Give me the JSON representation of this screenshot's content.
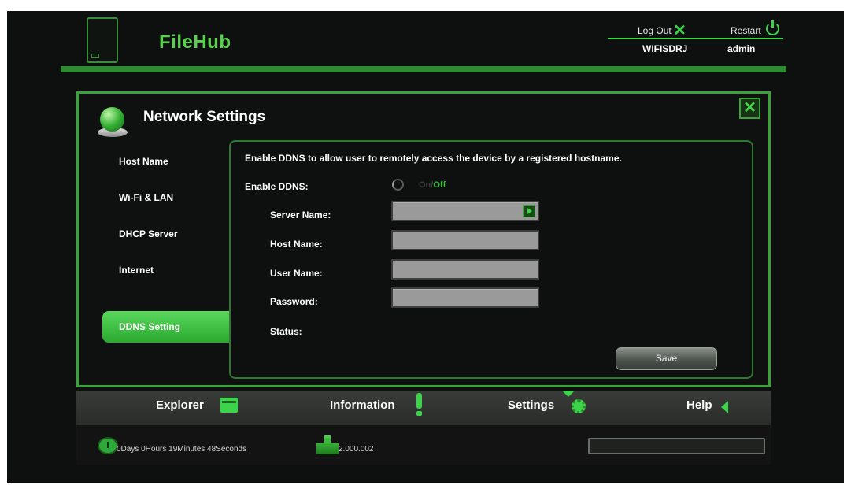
{
  "app": {
    "brand": "FileHub"
  },
  "header": {
    "logout_label": "Log Out",
    "restart_label": "Restart",
    "device_name": "WIFISDRJ",
    "username": "admin"
  },
  "panel": {
    "title": "Network Settings"
  },
  "sidebar": {
    "items": [
      {
        "label": "Host Name"
      },
      {
        "label": "Wi-Fi & LAN"
      },
      {
        "label": "DHCP Server"
      },
      {
        "label": "Internet"
      },
      {
        "label": "DDNS Setting",
        "active": true
      }
    ]
  },
  "ddns": {
    "description": "Enable DDNS to allow user to remotely access the device by a registered hostname.",
    "enable_label": "Enable DDNS:",
    "toggle_on": "On",
    "toggle_sep": "/",
    "toggle_off": "Off",
    "toggle_state": "Off",
    "server_name_label": "Server Name:",
    "server_name_value": "",
    "host_name_label": "Host Name:",
    "host_name_value": "",
    "user_name_label": "User Name:",
    "user_name_value": "",
    "password_label": "Password:",
    "password_value": "",
    "status_label": "Status:",
    "status_value": "",
    "save_label": "Save"
  },
  "tabs": [
    {
      "label": "Explorer",
      "icon": "folder-icon"
    },
    {
      "label": "Information",
      "icon": "exclamation-icon"
    },
    {
      "label": "Settings",
      "icon": "gear-icon",
      "active": true
    },
    {
      "label": "Help",
      "icon": "arrow-left-icon"
    }
  ],
  "status": {
    "uptime": "0Days 0Hours 19Minutes 48Seconds",
    "firmware": "2.000.002"
  },
  "colors": {
    "accent": "#3bd44a",
    "active_tab": "#2fba3c",
    "field_bg": "#9a9a9a",
    "background": "#0e0f0f"
  }
}
